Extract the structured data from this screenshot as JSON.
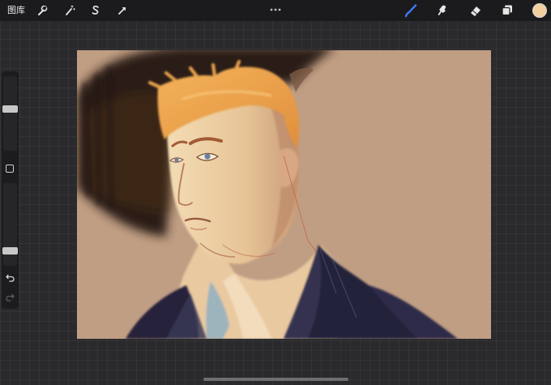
{
  "toolbar": {
    "gallery_label": "图库",
    "left_tools": [
      "wrench-icon",
      "magic-wand-icon",
      "selection-s-icon",
      "transform-arrow-icon"
    ],
    "more_icon": "more-dots-icon",
    "right_tools": [
      "brush-icon",
      "smudge-icon",
      "eraser-icon",
      "layers-icon"
    ],
    "active_tool": "brush",
    "active_color": "#f2cfa0",
    "accent_color": "#3d7bf5"
  },
  "sidebar": {
    "brush_size": 0.57,
    "opacity": 0.15,
    "modify_button": "square-icon",
    "undo_icon": "undo-icon",
    "redo_icon": "redo-icon"
  },
  "canvas": {
    "content": "digital-painting-portrait",
    "background_color": "#c09e84"
  }
}
